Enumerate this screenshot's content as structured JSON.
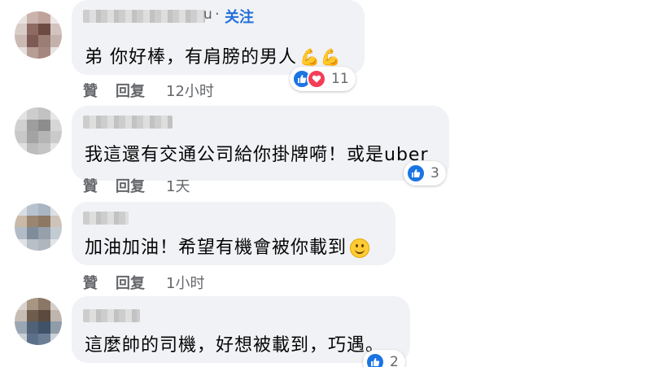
{
  "comments": [
    {
      "name_suffix": "u",
      "follow_label": "关注",
      "text": "弟 你好棒，有肩膀的男人",
      "emoji": "💪💪",
      "reaction_count": "11",
      "reactions": [
        "like-icon",
        "love-icon"
      ],
      "like_label": "贊",
      "reply_label": "回复",
      "time": "12小时"
    },
    {
      "text": "我這還有交通公司給你掛牌嗬！或是uber",
      "reaction_count": "3",
      "reactions": [
        "like-icon"
      ],
      "like_label": "贊",
      "reply_label": "回复",
      "time": "1天"
    },
    {
      "text": "加油加油！希望有機會被你載到",
      "emoji": "smile-emoji",
      "like_label": "贊",
      "reply_label": "回复",
      "time": "1小时"
    },
    {
      "text": "這麼帥的司機，好想被載到，巧遇。",
      "reaction_count": "2",
      "reactions": [
        "like-icon"
      ]
    }
  ],
  "colors": {
    "bubble": "#f0f2f5",
    "follow": "#216fdb",
    "like": "#1b74e4",
    "love": "#f33e58",
    "meta": "#65676b"
  }
}
